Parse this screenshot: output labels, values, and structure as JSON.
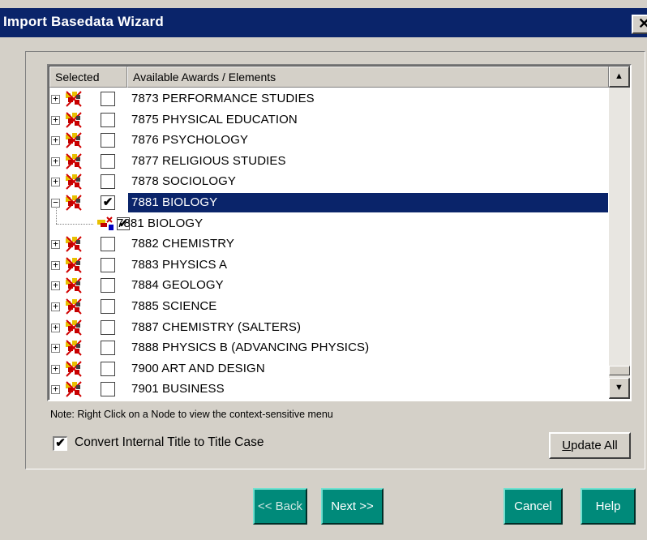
{
  "window": {
    "title": "Import Basedata Wizard",
    "close_glyph": "✕"
  },
  "tree": {
    "columns": [
      "Selected",
      "Available Awards / Elements"
    ],
    "rows": [
      {
        "label": "7873 PERFORMANCE STUDIES",
        "checked": "",
        "expander": "+"
      },
      {
        "label": "7875 PHYSICAL EDUCATION",
        "checked": "",
        "expander": "+"
      },
      {
        "label": "7876 PSYCHOLOGY",
        "checked": "",
        "expander": "+"
      },
      {
        "label": "7877 RELIGIOUS STUDIES",
        "checked": "",
        "expander": "+"
      },
      {
        "label": "7878 SOCIOLOGY",
        "checked": "",
        "expander": "+"
      },
      {
        "label": "7881 BIOLOGY",
        "checked": "✔",
        "expander": "−",
        "selected": true
      },
      {
        "label": "7881 BIOLOGY",
        "checked": "✔",
        "child": true
      },
      {
        "label": "7882 CHEMISTRY",
        "checked": "",
        "expander": "+"
      },
      {
        "label": "7883 PHYSICS A",
        "checked": "",
        "expander": "+"
      },
      {
        "label": "7884 GEOLOGY",
        "checked": "",
        "expander": "+"
      },
      {
        "label": "7885 SCIENCE",
        "checked": "",
        "expander": "+"
      },
      {
        "label": "7887 CHEMISTRY (SALTERS)",
        "checked": "",
        "expander": "+"
      },
      {
        "label": "7888 PHYSICS B (ADVANCING PHYSICS)",
        "checked": "",
        "expander": "+"
      },
      {
        "label": "7900 ART AND DESIGN",
        "checked": "",
        "expander": "+"
      },
      {
        "label": "7901 BUSINESS",
        "checked": "",
        "expander": "+"
      }
    ],
    "scroll_up": "▲",
    "scroll_down": "▼"
  },
  "note": "Note: Right Click on a Node to view the context-sensitive menu",
  "option": {
    "label": "Convert Internal Title to Title Case",
    "checked": "✔"
  },
  "buttons": {
    "update_all_accel": "U",
    "update_all_rest": "pdate All",
    "back": "<< Back",
    "next": "Next >>",
    "cancel": "Cancel",
    "help": "Help"
  },
  "colors": {
    "title_bar": "#0a246a",
    "selection": "#0a246a",
    "nav_button": "#008a7a",
    "face": "#d4d0c8"
  }
}
